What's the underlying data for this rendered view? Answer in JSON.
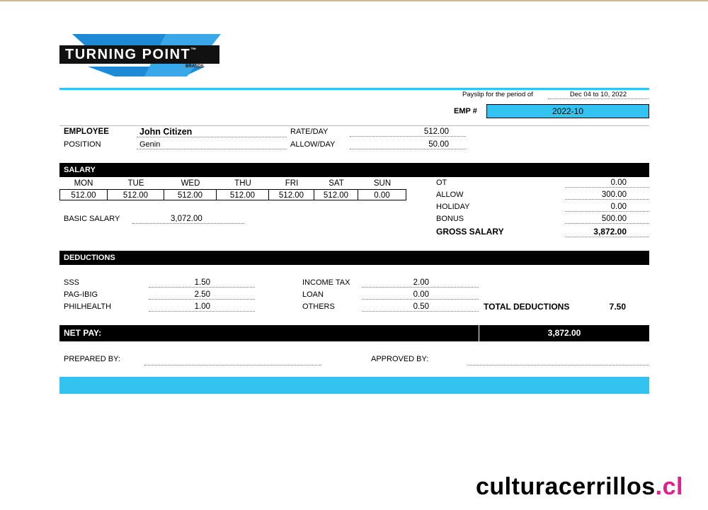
{
  "logo": {
    "name": "TURNING POINT",
    "tm": "™",
    "sub": "BRANDS"
  },
  "header": {
    "period_label": "Payslip for the period of",
    "period_value": "Dec 04 to 10, 2022",
    "emp_label": "EMP #",
    "emp_value": "2022-10"
  },
  "employee": {
    "employee_label": "EMPLOYEE",
    "employee_name": "John Citizen",
    "position_label": "POSITION",
    "position_value": "Genin",
    "rate_label": "RATE/DAY",
    "rate_value": "512.00",
    "allow_label": "ALLOW/DAY",
    "allow_value": "50.00"
  },
  "salary": {
    "title": "SALARY",
    "days": [
      "MON",
      "TUE",
      "WED",
      "THU",
      "FRI",
      "SAT",
      "SUN"
    ],
    "day_values": [
      "512.00",
      "512.00",
      "512.00",
      "512.00",
      "512.00",
      "512.00",
      "0.00"
    ],
    "basic_label": "BASIC SALARY",
    "basic_value": "3,072.00",
    "ot_label": "OT",
    "ot_value": "0.00",
    "allow_label": "ALLOW",
    "allow_value": "300.00",
    "holiday_label": "HOLIDAY",
    "holiday_value": "0.00",
    "bonus_label": "BONUS",
    "bonus_value": "500.00",
    "gross_label": "GROSS SALARY",
    "gross_value": "3,872.00"
  },
  "deductions": {
    "title": "DEDUCTIONS",
    "sss_label": "SSS",
    "sss_value": "1.50",
    "pagibig_label": "PAG-IBIG",
    "pagibig_value": "2.50",
    "philhealth_label": "PHILHEALTH",
    "philhealth_value": "1.00",
    "tax_label": "INCOME TAX",
    "tax_value": "2.00",
    "loan_label": "LOAN",
    "loan_value": "0.00",
    "others_label": "OTHERS",
    "others_value": "0.50",
    "total_label": "TOTAL DEDUCTIONS",
    "total_value": "7.50"
  },
  "netpay": {
    "label": "NET PAY:",
    "value": "3,872.00"
  },
  "signoff": {
    "prepared_label": "PREPARED BY:",
    "approved_label": "APPROVED BY:"
  },
  "watermark": {
    "main": "culturacerrillos",
    "tld": ".cl"
  },
  "colors": {
    "accent_blue": "#33c3f0",
    "bar_black": "#000000",
    "watermark_pink": "#e3208a"
  }
}
